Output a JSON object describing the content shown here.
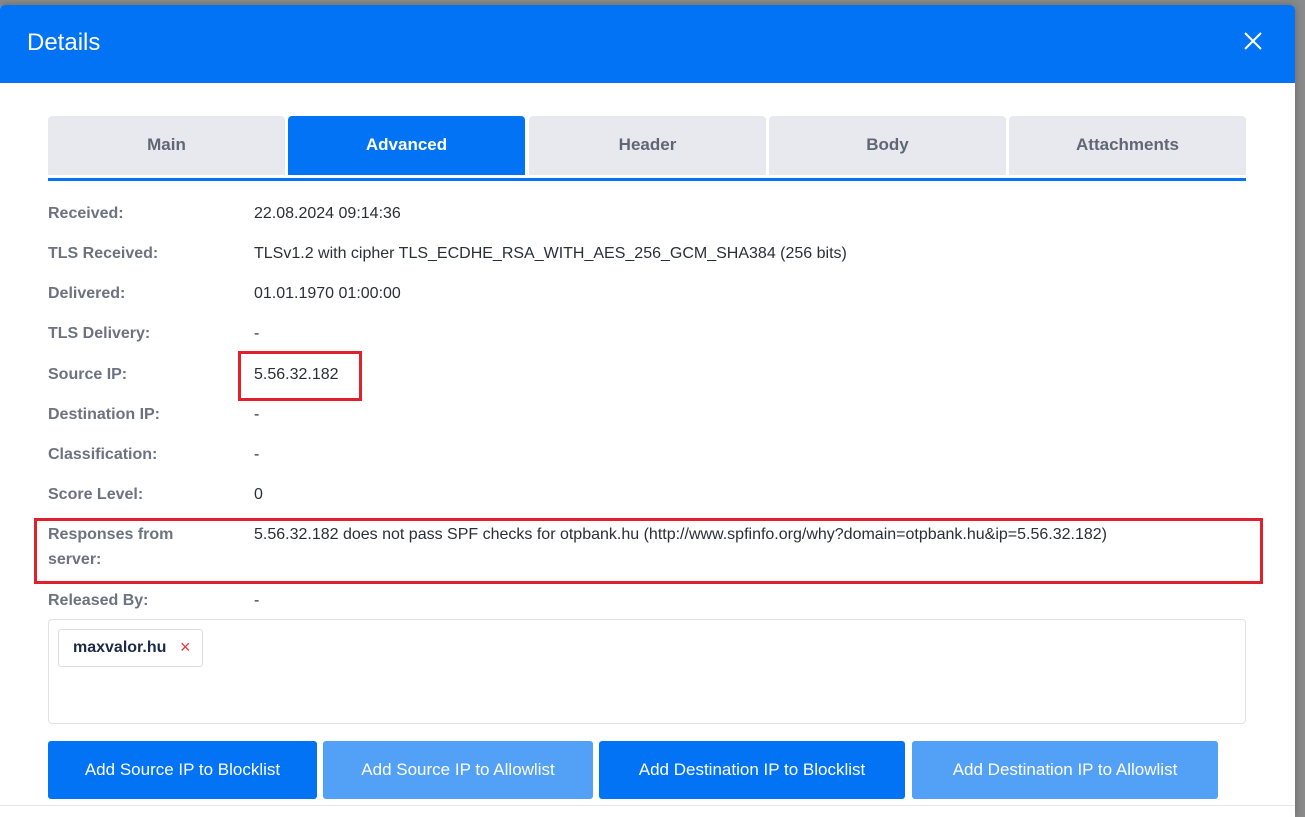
{
  "modal": {
    "title": "Details"
  },
  "tabs": [
    {
      "label": "Main"
    },
    {
      "label": "Advanced"
    },
    {
      "label": "Header"
    },
    {
      "label": "Body"
    },
    {
      "label": "Attachments"
    }
  ],
  "active_tab": "Advanced",
  "details": {
    "received": {
      "label": "Received:",
      "value": "22.08.2024 09:14:36"
    },
    "tls_received": {
      "label": "TLS Received:",
      "value": "TLSv1.2 with cipher TLS_ECDHE_RSA_WITH_AES_256_GCM_SHA384 (256 bits)"
    },
    "delivered": {
      "label": "Delivered:",
      "value": "01.01.1970 01:00:00"
    },
    "tls_delivery": {
      "label": "TLS Delivery:",
      "value": "-"
    },
    "source_ip": {
      "label": "Source IP:",
      "value": "5.56.32.182"
    },
    "destination_ip": {
      "label": "Destination IP:",
      "value": "-"
    },
    "classification": {
      "label": "Classification:",
      "value": "-"
    },
    "score_level": {
      "label": "Score Level:",
      "value": "0"
    },
    "responses": {
      "label_line1": "Responses from",
      "label_line2": "server:",
      "value": "5.56.32.182 does not pass SPF checks for otpbank.hu (http://www.spfinfo.org/why?domain=otpbank.hu&ip=5.56.32.182)"
    },
    "released_by": {
      "label": "Released By:",
      "value": "-"
    }
  },
  "tags": [
    {
      "text": "maxvalor.hu",
      "remove_icon": "×"
    }
  ],
  "buttons": {
    "add_source_blocklist": "Add Source IP to Blocklist",
    "add_source_allowlist": "Add Source IP to Allowlist",
    "add_destination_blocklist": "Add Destination IP to Blocklist",
    "add_destination_allowlist": "Add Destination IP to Allowlist"
  },
  "colors": {
    "primary": "#0273f5",
    "primary_light": "#53a0f7",
    "highlight": "#e0202d"
  }
}
